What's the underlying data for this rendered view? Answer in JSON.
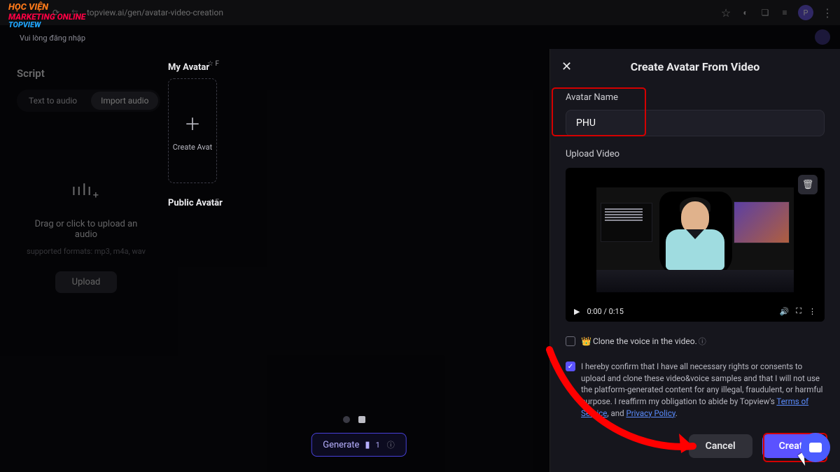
{
  "browser": {
    "url": "topview.ai/gen/avatar-video-creation",
    "profile_initial": "P"
  },
  "brand_overlay": {
    "line1": "HỌC VIỆN",
    "line2": "MARKETING ONLINE",
    "line3": "TOPVIEW",
    "sub": "Vui lòng đăng nhập"
  },
  "left": {
    "title": "Script",
    "tab_text": "Text to audio",
    "tab_import": "Import audio",
    "upload_hint": "Drag or click to upload an audio",
    "upload_formats": "supported formats: mp3, m4a, wav",
    "upload_btn": "Upload"
  },
  "mid": {
    "my_avatar": "My Avatar",
    "create_avatar": "Create Avat",
    "public_avatar": "Public Avatar",
    "generate": "Generate",
    "gen_cost": "1"
  },
  "panel": {
    "title": "Create Avatar From Video",
    "name_label": "Avatar Name",
    "name_value": "PHU",
    "upload_label": "Upload Video",
    "time": "0:00 / 0:15",
    "clone_label": "Clone the voice in the video.",
    "consent_pre": "I hereby confirm that I have all necessary rights or consents to upload and clone these video&voice samples and that I will not use the platform-generated content for any illegal, fraudulent, or harmful purpose. I reaffirm my obligation to abide by Topview's ",
    "tos": "Terms of Service",
    "and": ", and ",
    "pp": "Privacy Policy",
    "dot": ".",
    "cancel": "Cancel",
    "create": "Create"
  }
}
